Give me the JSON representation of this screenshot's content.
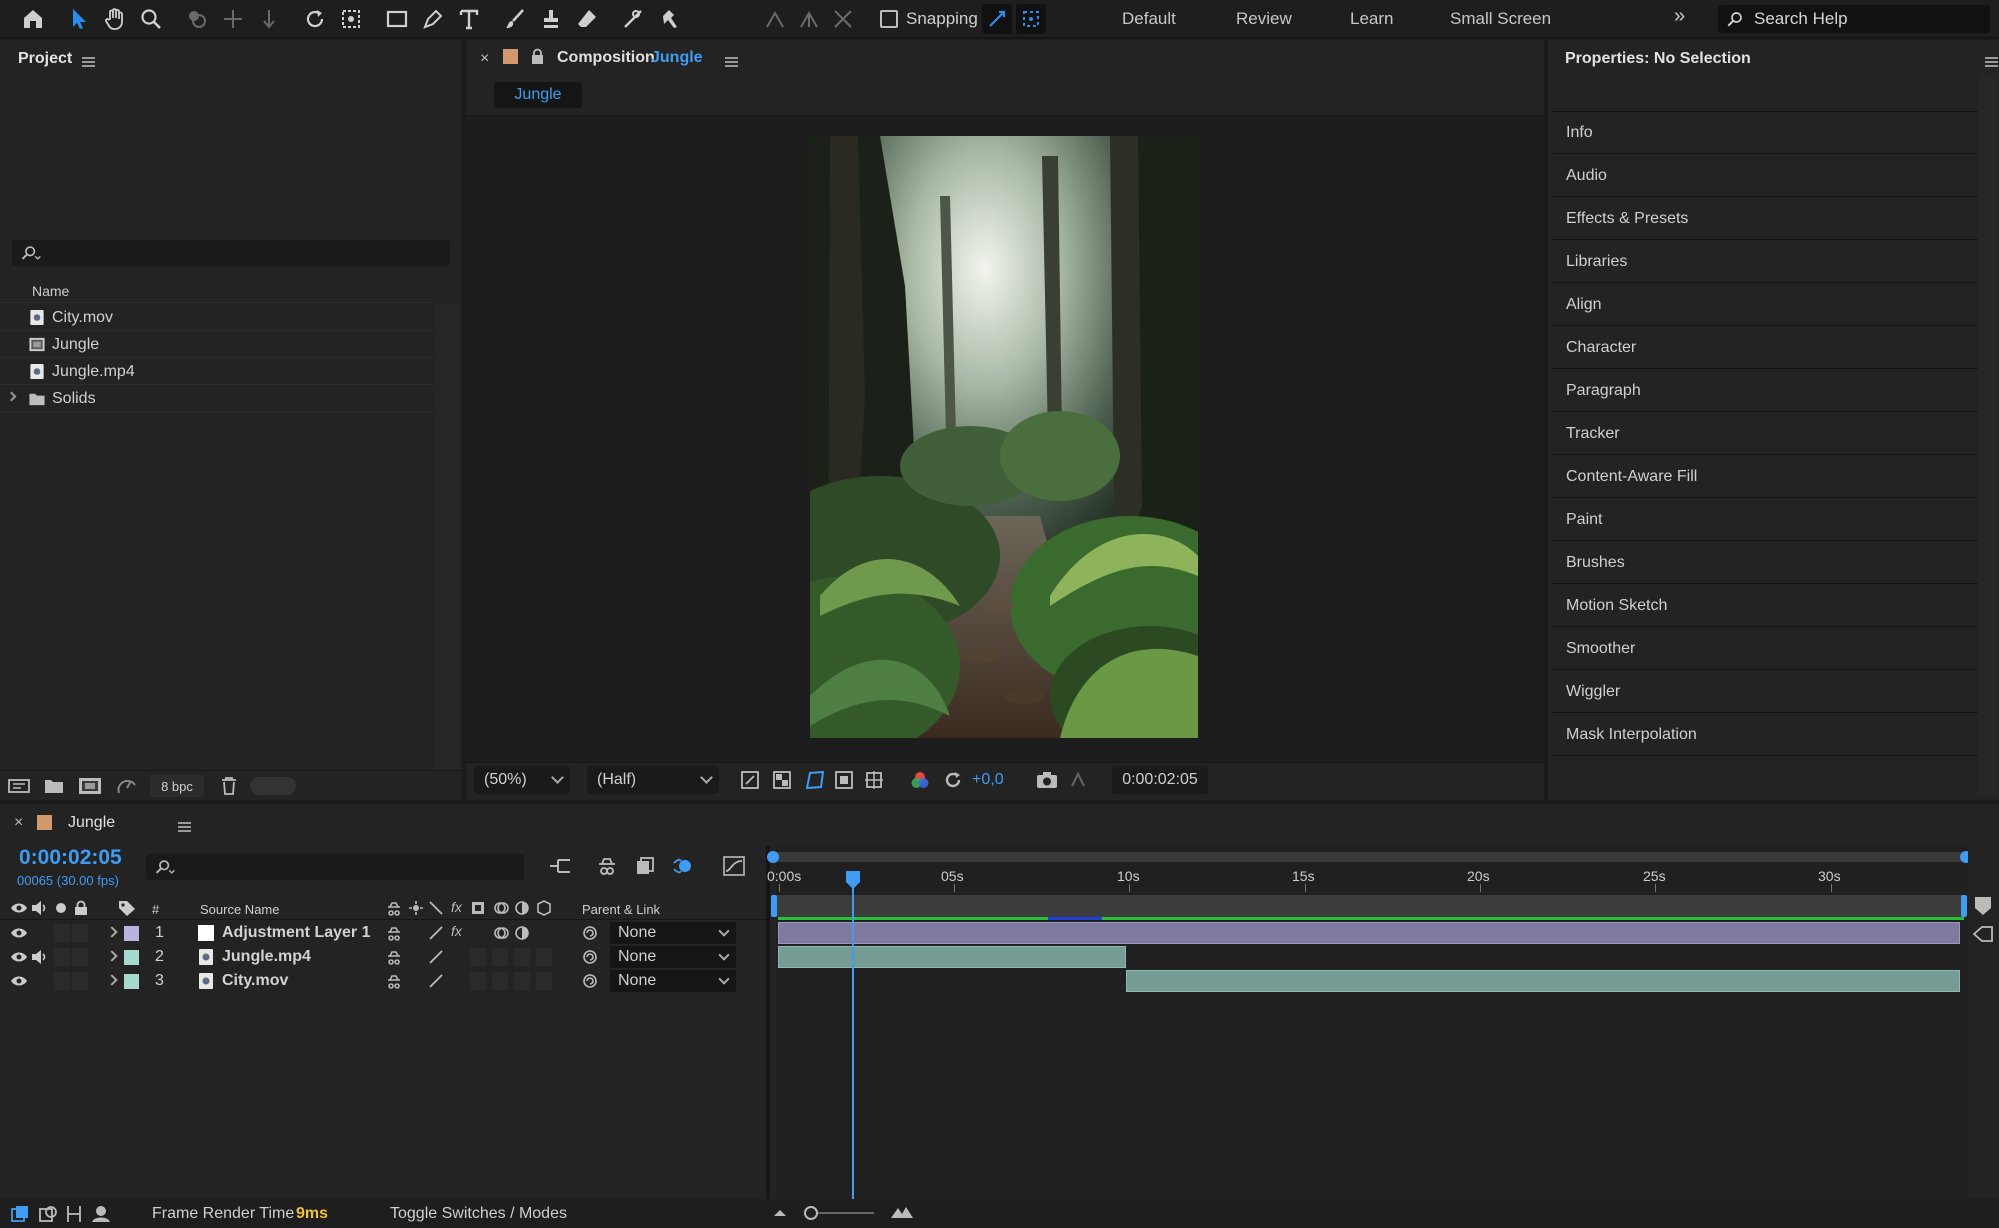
{
  "toolbar": {
    "snapping_label": "Snapping",
    "workspaces": [
      "Default",
      "Review",
      "Learn",
      "Small Screen"
    ],
    "search_placeholder": "Search Help"
  },
  "project": {
    "title": "Project",
    "column_name": "Name",
    "items": [
      {
        "label": "City.mov",
        "type": "footage"
      },
      {
        "label": "Jungle",
        "type": "composition"
      },
      {
        "label": "Jungle.mp4",
        "type": "footage"
      },
      {
        "label": "Solids",
        "type": "folder"
      }
    ],
    "bpc": "8 bpc"
  },
  "composition": {
    "title_prefix": "Composition",
    "name": "Jungle",
    "tab": "Jungle",
    "zoom": "(50%)",
    "resolution": "(Half)",
    "exposure": "+0,0",
    "timecode": "0:00:02:05"
  },
  "properties": {
    "title": "Properties: No Selection",
    "items": [
      "Info",
      "Audio",
      "Effects & Presets",
      "Libraries",
      "Align",
      "Character",
      "Paragraph",
      "Tracker",
      "Content-Aware Fill",
      "Paint",
      "Brushes",
      "Motion Sketch",
      "Smoother",
      "Wiggler",
      "Mask Interpolation"
    ]
  },
  "timeline": {
    "tab": "Jungle",
    "current_time": "0:00:02:05",
    "frame_info": "00065 (30.00 fps)",
    "col_hash": "#",
    "col_source": "Source Name",
    "col_parent": "Parent & Link",
    "ruler": [
      "0:00s",
      "05s",
      "10s",
      "15s",
      "20s",
      "25s",
      "30s"
    ],
    "layers": [
      {
        "num": "1",
        "name": "Adjustment Layer 1",
        "parent": "None",
        "color": "#b9b3e0"
      },
      {
        "num": "2",
        "name": "Jungle.mp4",
        "parent": "None",
        "color": "#a7d9cf"
      },
      {
        "num": "3",
        "name": "City.mov",
        "parent": "None",
        "color": "#a7d9cf"
      }
    ]
  },
  "status": {
    "frame_render_label": "Frame Render Time",
    "frame_render_value": "9ms",
    "toggle_label": "Toggle Switches / Modes"
  }
}
